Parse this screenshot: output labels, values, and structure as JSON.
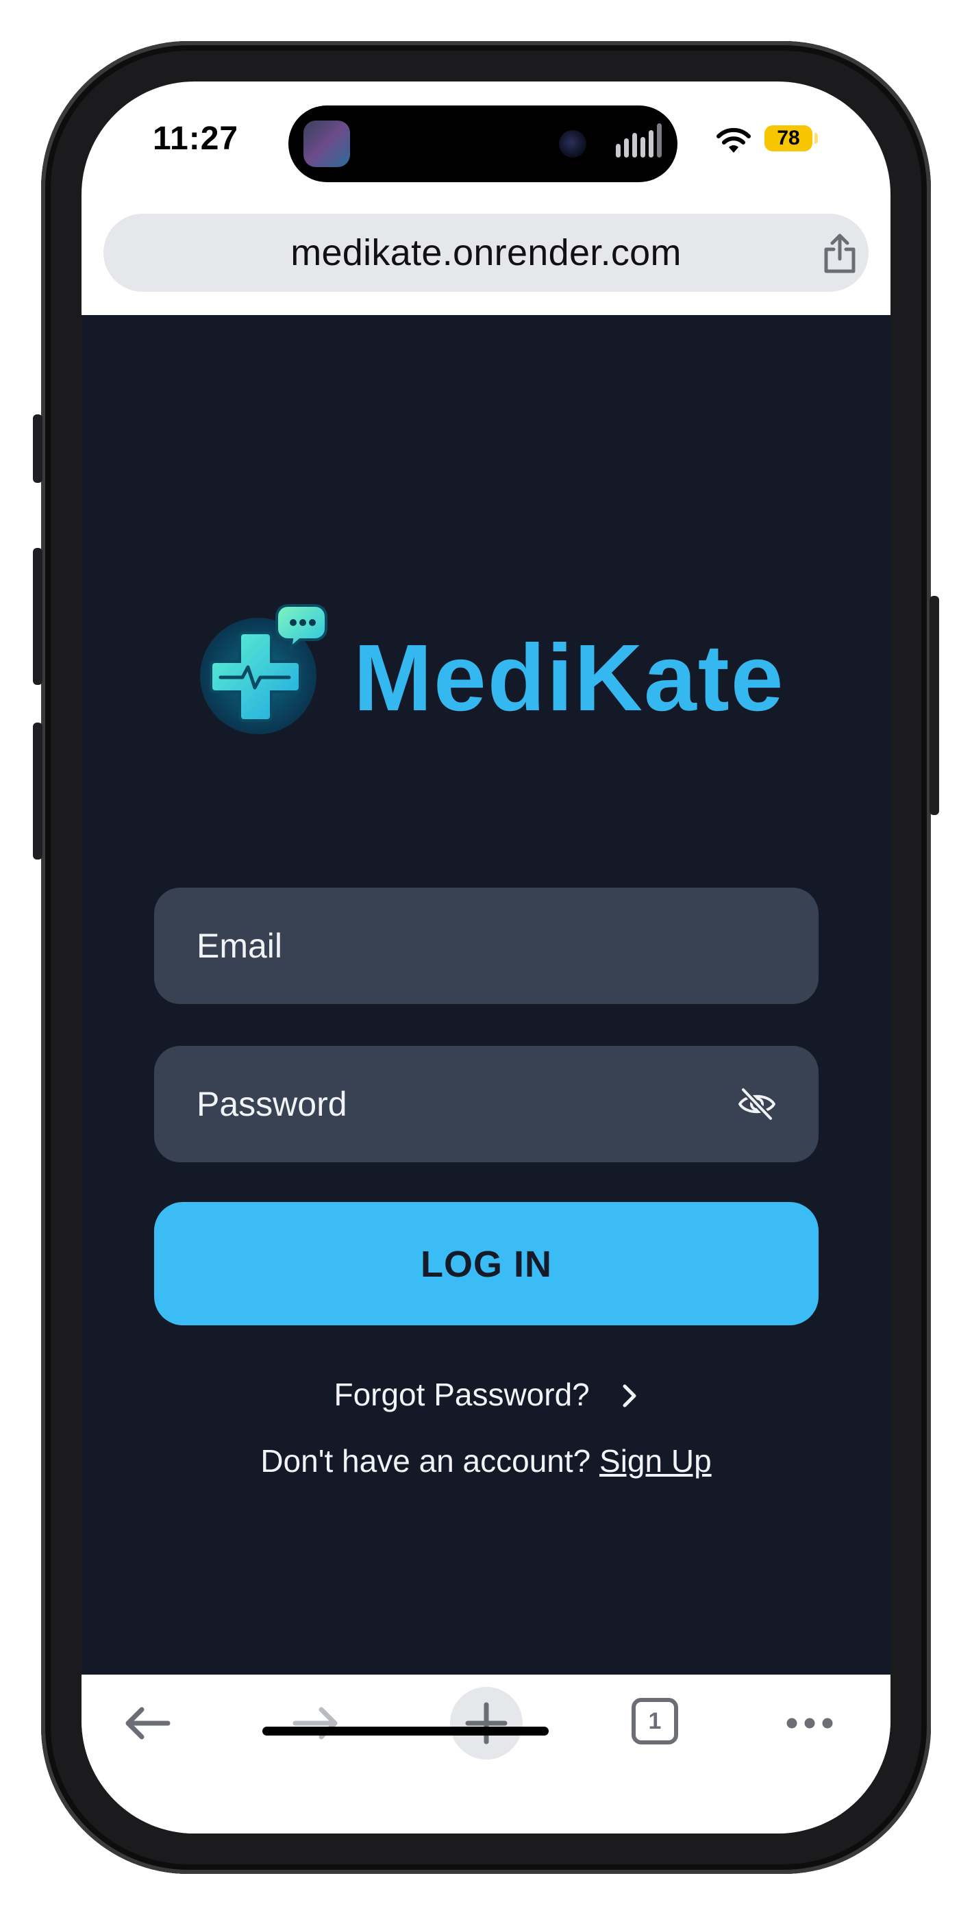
{
  "status_bar": {
    "time": "11:27",
    "battery": "78"
  },
  "browser": {
    "url": "medikate.onrender.com",
    "tab_count": "1"
  },
  "app": {
    "brand_name": "MediKate",
    "email_placeholder": "Email",
    "password_placeholder": "Password",
    "login_label": "LOG IN",
    "forgot_password": "Forgot Password?",
    "no_account_text": "Don't have an account?",
    "signup_label": "Sign Up"
  },
  "colors": {
    "background": "#131927",
    "field": "#394253",
    "accent": "#3bbcf5",
    "battery": "#f7c600"
  },
  "icons": {
    "share": "share-icon",
    "eye": "eye-slash-icon",
    "back": "arrow-left-icon",
    "forward": "arrow-right-icon",
    "new_tab": "plus-icon",
    "more": "ellipsis-icon"
  }
}
